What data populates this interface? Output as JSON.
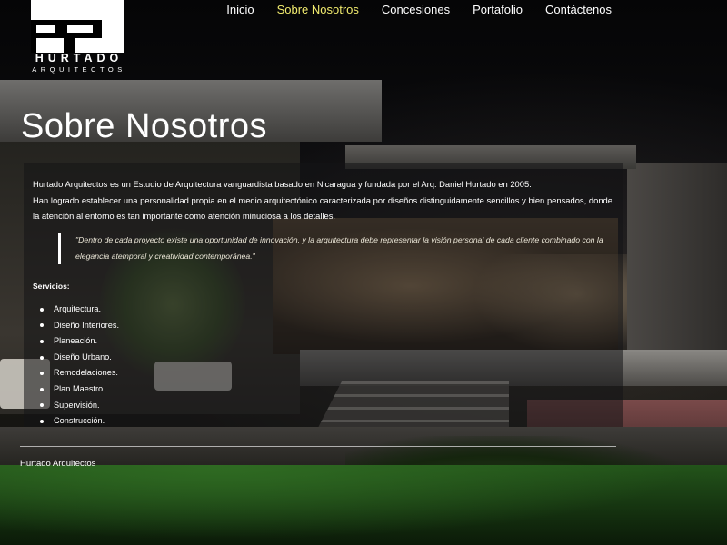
{
  "brand": {
    "name": "HURTADO",
    "subtitle": "ARQUITECTOS"
  },
  "nav": {
    "items": [
      {
        "label": "Inicio",
        "active": false
      },
      {
        "label": "Sobre Nosotros",
        "active": true
      },
      {
        "label": "Concesiones",
        "active": false
      },
      {
        "label": "Portafolio",
        "active": false
      },
      {
        "label": "Contáctenos",
        "active": false
      }
    ],
    "active_color": "#f1eb6e"
  },
  "page": {
    "title": "Sobre Nosotros",
    "intro_1": "Hurtado Arquitectos es un Estudio de Arquitectura vanguardista basado en Nicaragua y fundada por el Arq. Daniel Hurtado en 2005.",
    "intro_2": "Han logrado establecer una personalidad propia en el medio arquitectónico caracterizada por diseños distinguidamente sencillos y bien pensados, donde la atención al entorno es tan importante como atención minuciosa a los detalles.",
    "quote": "\"Dentro de cada proyecto existe una oportunidad de innovación, y la arquitectura debe representar la visión personal de cada cliente combinado con la elegancia atemporal y creatividad contemporánea.\"",
    "services_title": "Servicios:",
    "services": [
      "Arquitectura.",
      "Diseño Interiores.",
      "Planeación.",
      "Diseño Urbano.",
      "Remodelaciones.",
      "Plan Maestro.",
      "Supervisión.",
      "Construcción."
    ]
  },
  "footer": {
    "text": "Hurtado Arquitectos"
  }
}
